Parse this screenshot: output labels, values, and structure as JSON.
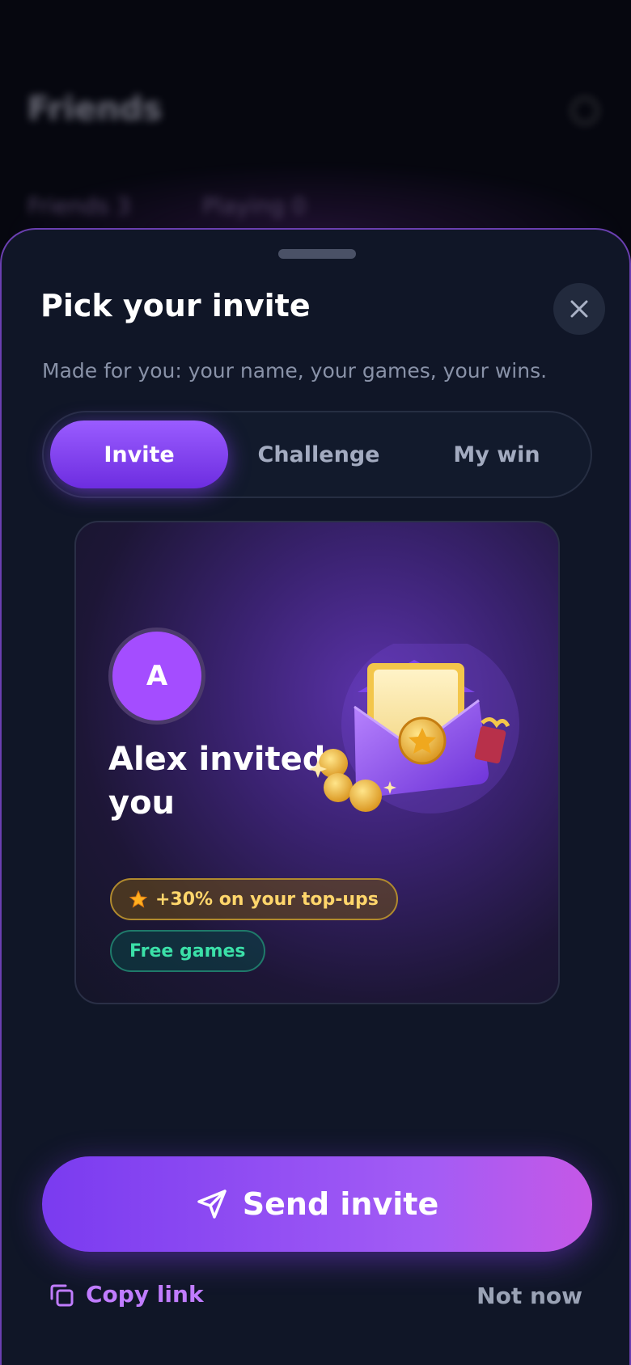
{
  "background": {
    "title": "Friends",
    "tabs": [
      "Friends 3",
      "Playing 0"
    ]
  },
  "sheet": {
    "title": "Pick your invite",
    "subtitle": "Made for you: your name, your games, your wins.",
    "close_icon": "close-icon"
  },
  "tabs": [
    {
      "label": "Invite",
      "active": true
    },
    {
      "label": "Challenge",
      "active": false
    },
    {
      "label": "My win",
      "active": false
    }
  ],
  "card": {
    "avatar_initial": "A",
    "headline": "Alex invited you",
    "badges": [
      {
        "icon": "star-icon",
        "label": "+30% on your top-ups",
        "color": "#ffd66b"
      },
      {
        "label": "Free games",
        "color": "#3be0a8"
      }
    ],
    "illustration": "envelope-with-coins"
  },
  "actions": {
    "send_label": "Send invite",
    "send_icon": "paper-plane-icon",
    "copy_label": "Copy link",
    "copy_icon": "copy-icon",
    "dismiss_label": "Not now"
  },
  "colors": {
    "accent": "#8b45f5",
    "sheet_bg": "#101627",
    "gold": "#ffd66b",
    "green": "#3be0a8"
  }
}
